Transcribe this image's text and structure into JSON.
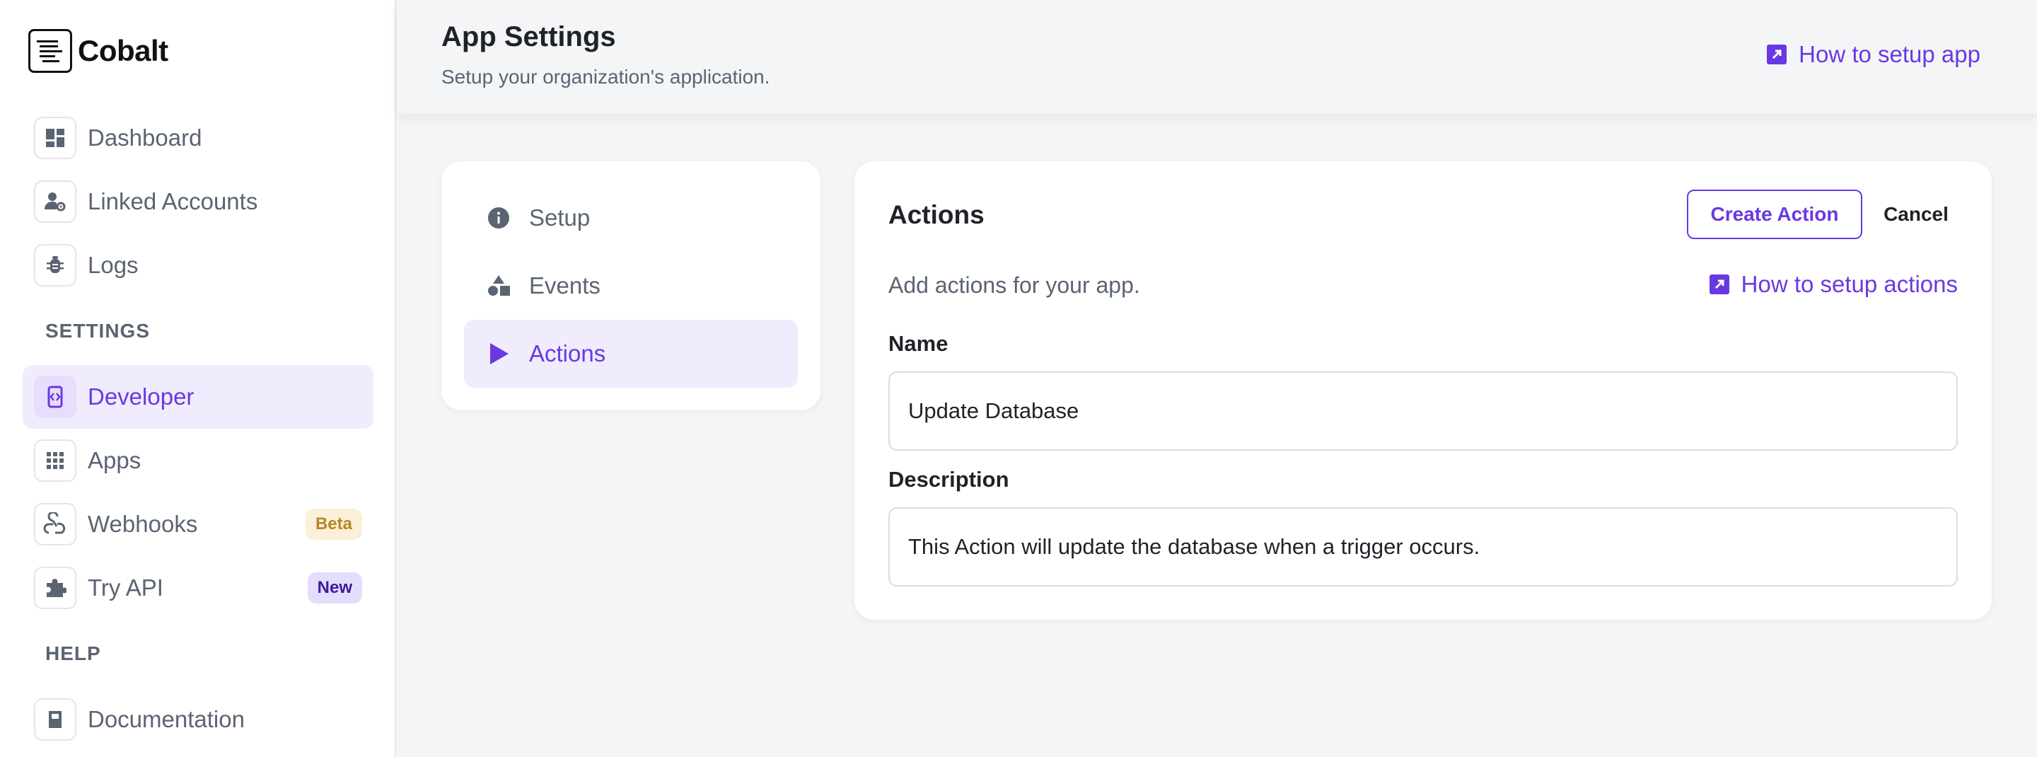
{
  "brand": {
    "name": "Cobalt"
  },
  "sidebar": {
    "items": [
      {
        "label": "Dashboard",
        "icon": "dashboard-icon"
      },
      {
        "label": "Linked Accounts",
        "icon": "user-gear-icon"
      },
      {
        "label": "Logs",
        "icon": "bug-icon"
      }
    ],
    "settings_title": "SETTINGS",
    "settings_items": [
      {
        "label": "Developer",
        "icon": "code-icon",
        "active": true
      },
      {
        "label": "Apps",
        "icon": "grid-icon"
      },
      {
        "label": "Webhooks",
        "icon": "webhook-icon",
        "badge": "Beta"
      },
      {
        "label": "Try API",
        "icon": "puzzle-icon",
        "badge": "New"
      }
    ],
    "help_title": "HELP",
    "help_items": [
      {
        "label": "Documentation",
        "icon": "book-icon"
      }
    ]
  },
  "header": {
    "title": "App Settings",
    "subtitle": "Setup your organization's application.",
    "help_link": "How to setup app"
  },
  "settings_menu": {
    "items": [
      {
        "label": "Setup",
        "icon": "info-icon"
      },
      {
        "label": "Events",
        "icon": "shapes-icon"
      },
      {
        "label": "Actions",
        "icon": "play-icon",
        "active": true
      }
    ]
  },
  "actions_card": {
    "title": "Actions",
    "create_button": "Create Action",
    "cancel_button": "Cancel",
    "description": "Add actions for your app.",
    "help_link": "How to setup actions",
    "name_label": "Name",
    "name_value": "Update Database",
    "description_label": "Description",
    "description_value": "This Action will update the database when a trigger occurs."
  },
  "colors": {
    "accent": "#6a38e3",
    "active_bg": "#f0ecfd",
    "muted_text": "#5b6472",
    "beta_bg": "#fbf0d8",
    "beta_text": "#b8862b",
    "new_bg": "#e4ddfb",
    "new_text": "#3e1a9e"
  }
}
